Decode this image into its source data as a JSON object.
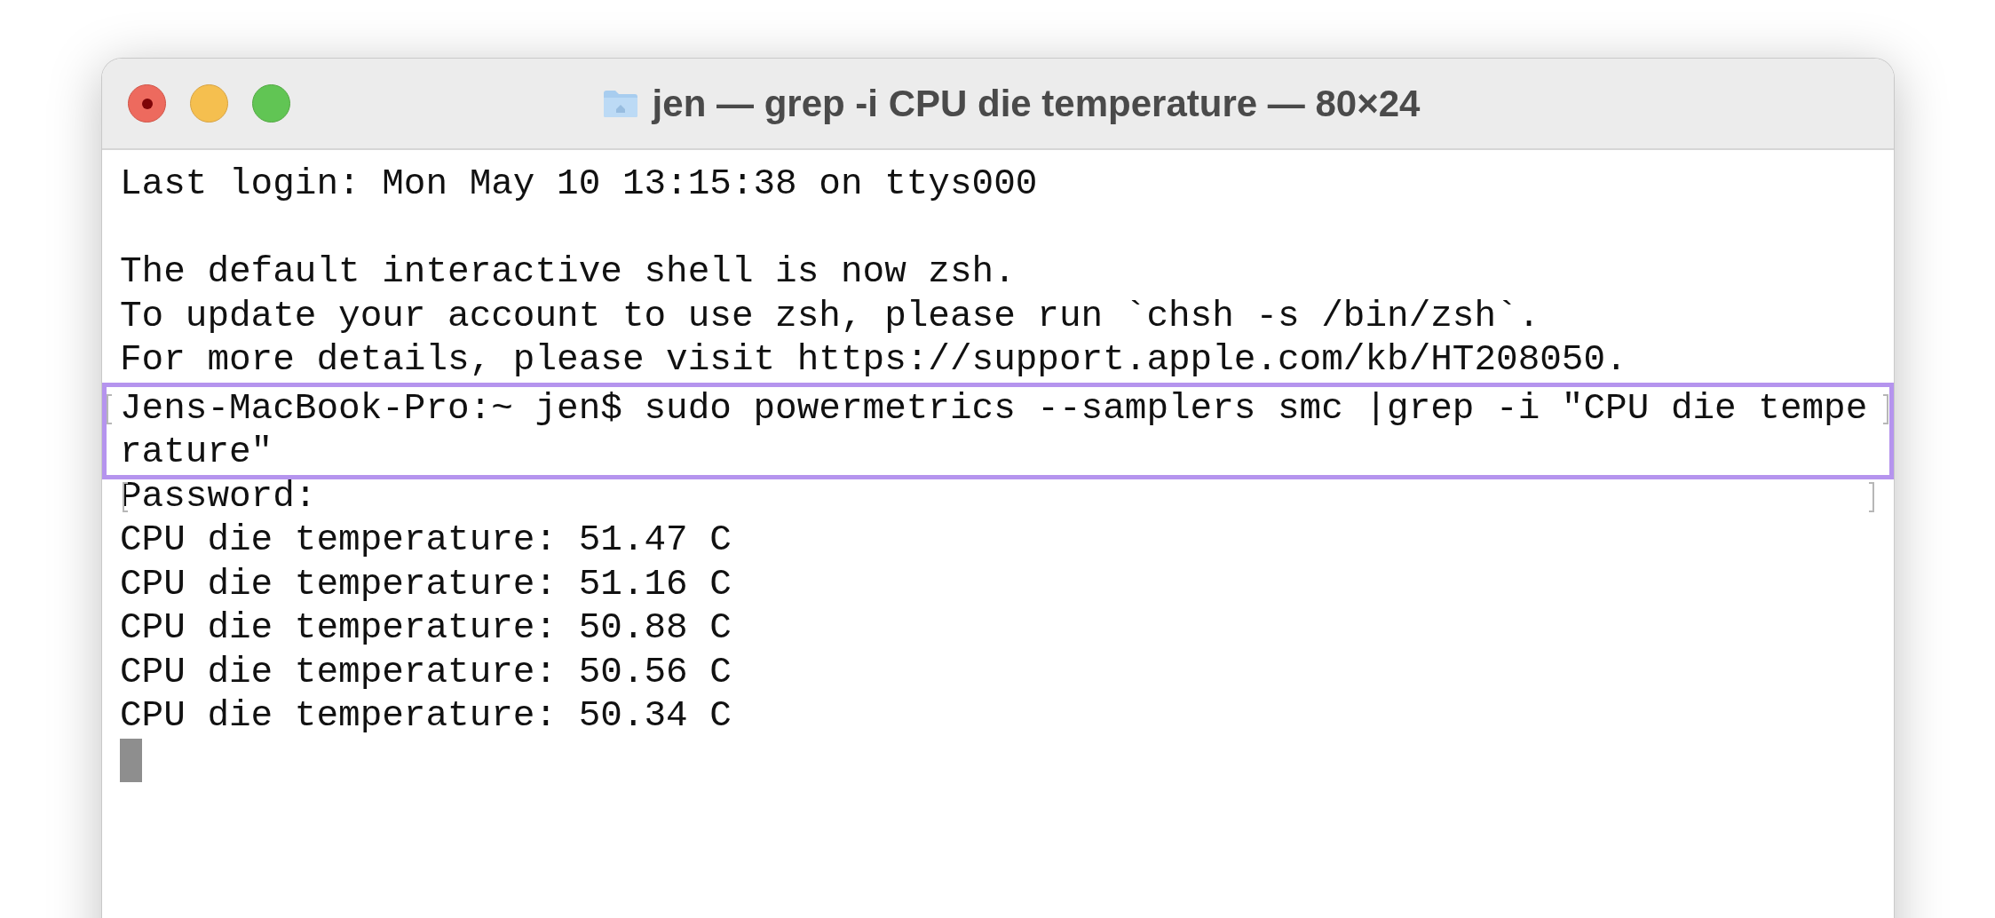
{
  "window": {
    "title": "jen — grep -i CPU die temperature — 80×24"
  },
  "terminal": {
    "lines": [
      {
        "kind": "text",
        "text": "Last login: Mon May 10 13:15:38 on ttys000",
        "marked": false,
        "highlighted": false
      },
      {
        "kind": "blank"
      },
      {
        "kind": "text",
        "text": "The default interactive shell is now zsh.",
        "marked": false,
        "highlighted": false
      },
      {
        "kind": "text",
        "text": "To update your account to use zsh, please run `chsh -s /bin/zsh`.",
        "marked": false,
        "highlighted": false
      },
      {
        "kind": "text",
        "text": "For more details, please visit https://support.apple.com/kb/HT208050.",
        "marked": false,
        "highlighted": false
      },
      {
        "kind": "text",
        "text": "Jens-MacBook-Pro:~ jen$ sudo powermetrics --samplers smc |grep -i \"CPU die tempe",
        "wrap": "rature\"",
        "marked": true,
        "highlighted": true
      },
      {
        "kind": "text",
        "text": "Password:",
        "marked": true,
        "highlighted": false
      },
      {
        "kind": "text",
        "text": "CPU die temperature: 51.47 C",
        "marked": false,
        "highlighted": false
      },
      {
        "kind": "text",
        "text": "CPU die temperature: 51.16 C",
        "marked": false,
        "highlighted": false
      },
      {
        "kind": "text",
        "text": "CPU die temperature: 50.88 C",
        "marked": false,
        "highlighted": false
      },
      {
        "kind": "text",
        "text": "CPU die temperature: 50.56 C",
        "marked": false,
        "highlighted": false
      },
      {
        "kind": "text",
        "text": "CPU die temperature: 50.34 C",
        "marked": false,
        "highlighted": false
      },
      {
        "kind": "cursor"
      }
    ]
  }
}
